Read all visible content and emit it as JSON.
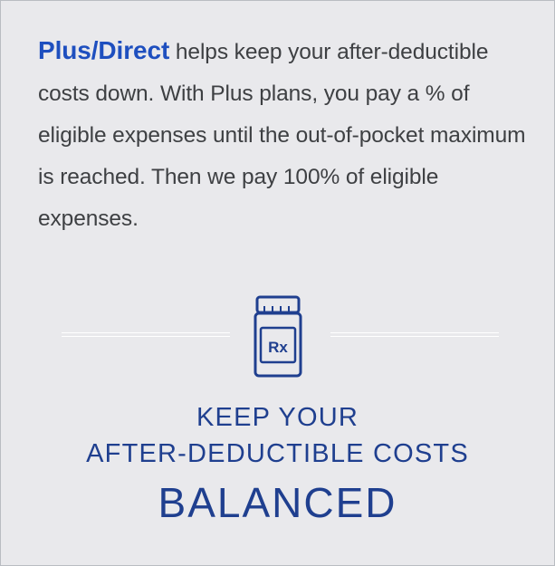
{
  "intro": {
    "brand": "Plus/Direct",
    "text": " helps keep your after-deductible costs down. With Plus plans, you pay a % of eligible expenses until the out-of-pocket maximum is reached. Then we pay 100% of eligible expenses."
  },
  "icon": {
    "name": "prescription-bottle-icon",
    "label": "Rx"
  },
  "headline": {
    "line1": "KEEP YOUR",
    "line2": "AFTER-DEDUCTIBLE COSTS",
    "line3": "BALANCED"
  },
  "colors": {
    "brand": "#1e4fbf",
    "headline": "#1f3f8f",
    "body_text": "#3e4043",
    "background": "#e9e9ec"
  }
}
